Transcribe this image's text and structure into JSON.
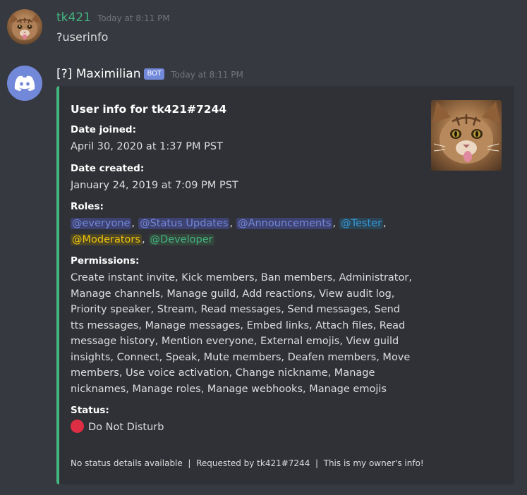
{
  "messages": [
    {
      "author": "tk421",
      "author_color": "#43b581",
      "timestamp": "Today at 8:11 PM",
      "content": "?userinfo",
      "avatar_icon": "cat-avatar-icon"
    },
    {
      "author": "[?] Maximilian",
      "author_color": "#ffffff",
      "bot_tag": "BOT",
      "timestamp": "Today at 8:11 PM",
      "avatar_icon": "discord-logo-icon"
    }
  ],
  "embed": {
    "accent_color": "#43b581",
    "title": "User info for tk421#7244",
    "fields": {
      "date_joined": {
        "name": "Date joined:",
        "value": "April 30, 2020 at 1:37 PM PST"
      },
      "date_created": {
        "name": "Date created:",
        "value": "January 24, 2019 at 7:09 PM PST"
      },
      "roles": {
        "name": "Roles:",
        "items": [
          {
            "label": "@everyone",
            "color": "#7289da",
            "bg": "#3e4270"
          },
          {
            "label": "@Status Updates",
            "color": "#7289da",
            "bg": "#3e4270"
          },
          {
            "label": "@Announcements",
            "color": "#7289da",
            "bg": "#3e4270"
          },
          {
            "label": "@Tester",
            "color": "#3498db",
            "bg": "#2c4555"
          },
          {
            "label": "@Moderators",
            "color": "#f1c40f",
            "bg": "#4c4626"
          },
          {
            "label": "@Developer",
            "color": "#43b581",
            "bg": "#34453c"
          }
        ]
      },
      "permissions": {
        "name": "Permissions:",
        "value": "Create instant invite, Kick members, Ban members, Administrator, Manage channels, Manage guild, Add reactions, View audit log, Priority speaker, Stream, Read messages, Send messages, Send tts messages, Manage messages, Embed links, Attach files, Read message history, Mention everyone, External emojis, View guild insights, Connect, Speak, Mute members, Deafen members, Move members, Use voice activation, Change nickname, Manage nicknames, Manage roles, Manage webhooks, Manage emojis"
      },
      "status": {
        "name": "Status:",
        "value": "Do Not Disturb",
        "status_icon": "dnd-red-circle-icon",
        "status_color": "#dd2e44"
      }
    },
    "footer": "No status details available  |  Requested by tk421#7244  |  This is my owner's info!",
    "thumbnail_icon": "cat-thumbnail-icon"
  }
}
